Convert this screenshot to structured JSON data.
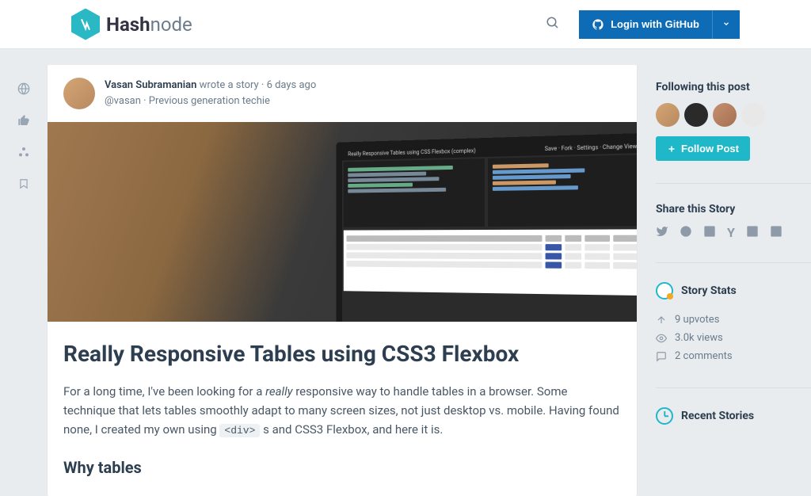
{
  "brand": {
    "bold": "Hash",
    "light": "node"
  },
  "header": {
    "login_label": "Login with GitHub"
  },
  "rail": {
    "icons": [
      "globe-icon",
      "thumbs-up-icon",
      "nodes-icon",
      "bookmark-icon"
    ]
  },
  "post": {
    "author_name": "Vasan Subramanian",
    "action": "wrote a story",
    "timestamp": "6 days ago",
    "handle": "@vasan",
    "tagline": "Previous generation techie",
    "hero_caption": "Really Responsive Tables using CSS Flexbox (complex)",
    "title": "Really Responsive Tables using CSS3 Flexbox",
    "body_html": "For a long time, I've been looking for a <em>really</em> responsive way to handle tables in a browser. Some technique that lets tables smoothly adapt to many screen sizes, not just desktop vs. mobile. Having found none, I created my own using <code>&lt;div&gt;</code> s and CSS3 Flexbox, and here it is.",
    "section2_heading": "Why tables"
  },
  "sidebar": {
    "following_heading": "Following this post",
    "follow_button": "Follow Post",
    "share_heading": "Share this Story",
    "share_icons": [
      "twitter-icon",
      "reddit-icon",
      "linkedin-icon",
      "hackernews-icon",
      "facebook-icon",
      "googleplus-icon"
    ],
    "stats_heading": "Story Stats",
    "stats": {
      "upvotes": "9 upvotes",
      "views": "3.0k views",
      "comments": "2 comments"
    },
    "recent_heading": "Recent Stories"
  }
}
